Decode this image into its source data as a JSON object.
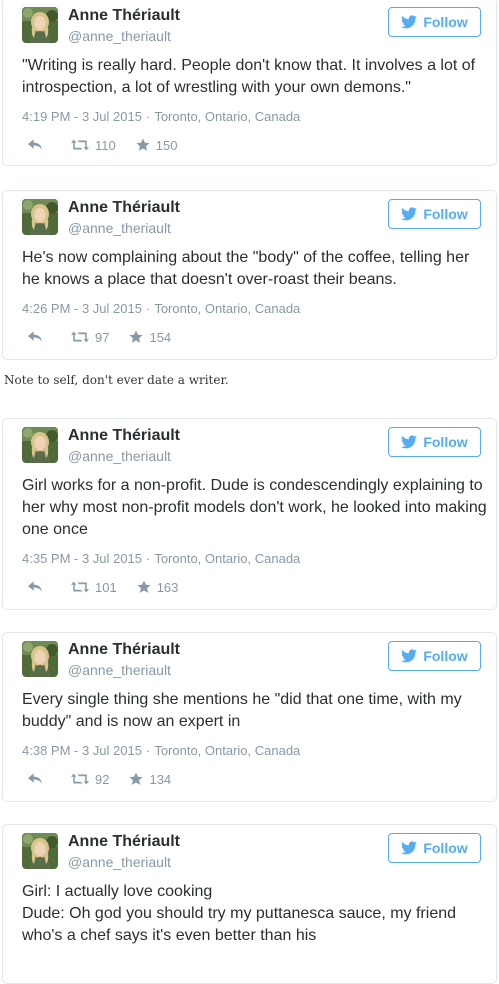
{
  "follow_label": "Follow",
  "note": "Note to self, don't ever date a writer.",
  "colors": {
    "accent": "#55acee",
    "muted": "#8899a6",
    "text": "#292f33",
    "border": "#e1e8ed"
  },
  "tweets": [
    {
      "name": "Anne Thériault",
      "handle": "@anne_theriault",
      "text": "\"Writing is really hard. People don't know that. It involves a lot of introspection, a lot of wrestling with your own demons.\"",
      "time": "4:19 PM - 3 Jul 2015",
      "location": "Toronto, Ontario, Canada",
      "retweets": "110",
      "favorites": "150"
    },
    {
      "name": "Anne Thériault",
      "handle": "@anne_theriault",
      "text": "He's now complaining about the \"body\" of the coffee, telling her he knows a place that doesn't over-roast their beans.",
      "time": "4:26 PM - 3 Jul 2015",
      "location": "Toronto, Ontario, Canada",
      "retweets": "97",
      "favorites": "154"
    },
    {
      "name": "Anne Thériault",
      "handle": "@anne_theriault",
      "text": "Girl works for a non-profit. Dude is condescendingly explaining to her why most non-profit models don't work, he looked into making one once",
      "time": "4:35 PM - 3 Jul 2015",
      "location": "Toronto, Ontario, Canada",
      "retweets": "101",
      "favorites": "163"
    },
    {
      "name": "Anne Thériault",
      "handle": "@anne_theriault",
      "text": "Every single thing she mentions he \"did that one time, with my buddy\" and is now an expert in",
      "time": "4:38 PM - 3 Jul 2015",
      "location": "Toronto, Ontario, Canada",
      "retweets": "92",
      "favorites": "134"
    },
    {
      "name": "Anne Thériault",
      "handle": "@anne_theriault",
      "text_lines": [
        "Girl: I actually love cooking",
        "Dude: Oh god you should try my puttanesca sauce, my friend who's a chef says it's even better than his"
      ]
    }
  ]
}
